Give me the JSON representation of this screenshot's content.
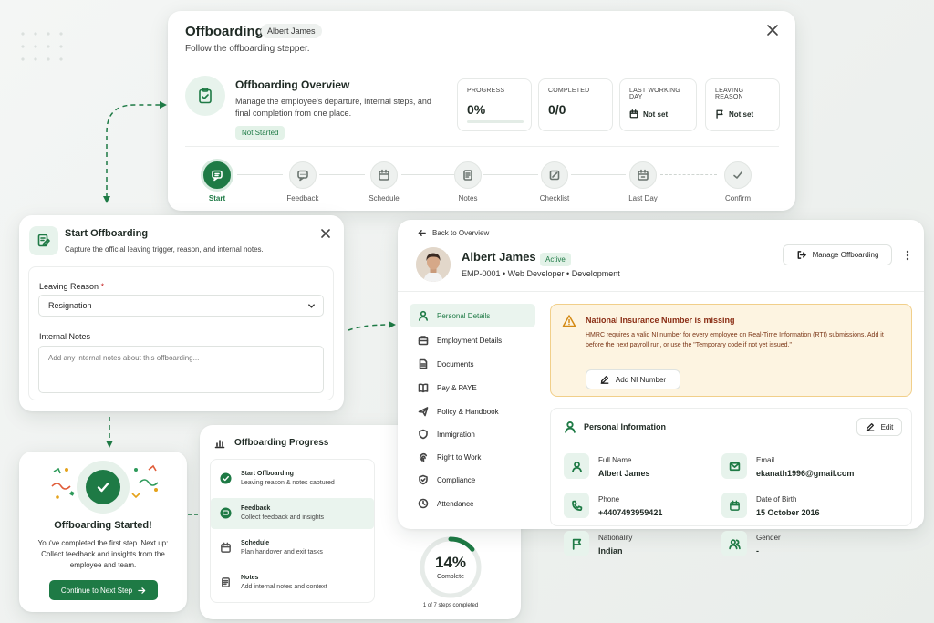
{
  "overview": {
    "title": "Offboarding",
    "employee_chip": "Albert James",
    "subtitle": "Follow the offboarding stepper.",
    "section_title": "Offboarding Overview",
    "section_desc": "Manage the employee's departure, internal steps, and final completion from one place.",
    "status": "Not Started",
    "stats": {
      "progress_label": "PROGRESS",
      "progress_value": "0%",
      "progress_fraction": 0,
      "completed_label": "COMPLETED",
      "completed_value": "0/0",
      "last_day_label": "LAST WORKING DAY",
      "last_day_value": "Not set",
      "reason_label": "LEAVING REASON",
      "reason_value": "Not set"
    },
    "steps": [
      {
        "label": "Start",
        "icon": "chat-icon",
        "active": true
      },
      {
        "label": "Feedback",
        "icon": "feedback-icon",
        "active": false
      },
      {
        "label": "Schedule",
        "icon": "calendar-icon",
        "active": false
      },
      {
        "label": "Notes",
        "icon": "notes-icon",
        "active": false
      },
      {
        "label": "Checklist",
        "icon": "checklist-icon",
        "active": false
      },
      {
        "label": "Last Day",
        "icon": "calendar-day-icon",
        "active": false
      },
      {
        "label": "Confirm",
        "icon": "check-icon",
        "active": false
      }
    ]
  },
  "start_modal": {
    "title": "Start Offboarding",
    "subtitle": "Capture the official leaving trigger, reason, and internal notes.",
    "reason_label": "Leaving Reason",
    "required_mark": "*",
    "reason_value": "Resignation",
    "notes_label": "Internal Notes",
    "notes_placeholder": "Add any internal notes about this offboarding..."
  },
  "success": {
    "title": "Offboarding Started!",
    "desc": "You've completed the first step. Next up: Collect feedback and insights from the employee and team.",
    "button": "Continue to Next Step"
  },
  "progress": {
    "title": "Offboarding Progress",
    "items": [
      {
        "title": "Start Offboarding",
        "desc": "Leaving reason & notes captured"
      },
      {
        "title": "Feedback",
        "desc": "Collect feedback and insights"
      },
      {
        "title": "Schedule",
        "desc": "Plan handover and exit tasks"
      },
      {
        "title": "Notes",
        "desc": "Add internal notes and context"
      }
    ],
    "percent_label": "14%",
    "percent_value": 14,
    "complete_label": "Complete",
    "steps_text": "1 of 7 steps completed"
  },
  "profile": {
    "back": "Back to Overview",
    "name": "Albert James",
    "status": "Active",
    "meta": "EMP-0001 • Web Developer • Development",
    "manage_button": "Manage Offboarding",
    "nav": [
      {
        "label": "Personal Details",
        "icon": "user-icon",
        "active": true
      },
      {
        "label": "Employment Details",
        "icon": "briefcase-icon",
        "active": false
      },
      {
        "label": "Documents",
        "icon": "document-icon",
        "active": false
      },
      {
        "label": "Pay & PAYE",
        "icon": "book-icon",
        "active": false
      },
      {
        "label": "Policy & Handbook",
        "icon": "plane-icon",
        "active": false
      },
      {
        "label": "Immigration",
        "icon": "shield-icon",
        "active": false
      },
      {
        "label": "Right to Work",
        "icon": "fingerprint-icon",
        "active": false
      },
      {
        "label": "Compliance",
        "icon": "shield-check-icon",
        "active": false
      },
      {
        "label": "Attendance",
        "icon": "clock-icon",
        "active": false
      }
    ],
    "alert": {
      "title": "National Insurance Number is missing",
      "desc": "HMRC requires a valid NI number for every employee on Real-Time Information (RTI) submissions. Add it before the next payroll run, or use the \"Temporary code if not yet issued.\"",
      "button": "Add NI Number"
    },
    "info": {
      "title": "Personal Information",
      "edit": "Edit",
      "fields": [
        {
          "label": "Full Name",
          "value": "Albert James"
        },
        {
          "label": "Email",
          "value": "ekanath1996@gmail.com"
        },
        {
          "label": "Phone",
          "value": "+4407493959421"
        },
        {
          "label": "Date of Birth",
          "value": "15 October 2016"
        },
        {
          "label": "Nationality",
          "value": "Indian"
        },
        {
          "label": "Gender",
          "value": "-"
        }
      ]
    }
  },
  "colors": {
    "brand": "#1e7a45",
    "alert_bg": "#fdf4e1",
    "alert_text": "#8a2d14"
  }
}
